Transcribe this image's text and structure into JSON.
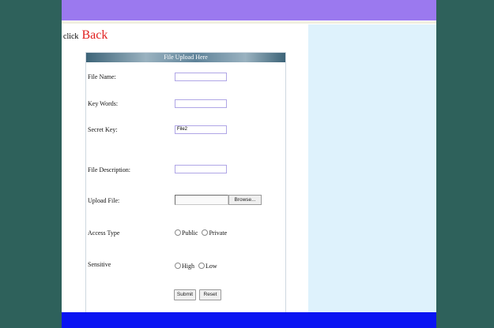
{
  "nav": {
    "prefix": "click",
    "back_label": "Back"
  },
  "form": {
    "title": "File Upload Here",
    "fields": [
      {
        "label": "File Name:",
        "value": ""
      },
      {
        "label": "Key Words:",
        "value": ""
      },
      {
        "label": "Secret Key:",
        "value": "File2"
      },
      {
        "label": "File Description:",
        "value": ""
      }
    ],
    "upload": {
      "label": "Upload File:",
      "browse_label": "Browse..."
    },
    "access_type": {
      "label": "Access Type",
      "options": [
        "Public",
        "Private"
      ]
    },
    "sensitive": {
      "label": "Sensitive",
      "options": [
        "High",
        "Low"
      ]
    },
    "buttons": {
      "submit": "Submit",
      "reset": "Reset"
    }
  },
  "colors": {
    "background": "#2e615b",
    "header_band": "#9b79ef",
    "side_panel": "#def2fc",
    "footer_band": "#0a14f2",
    "back_link": "#e0201f"
  }
}
